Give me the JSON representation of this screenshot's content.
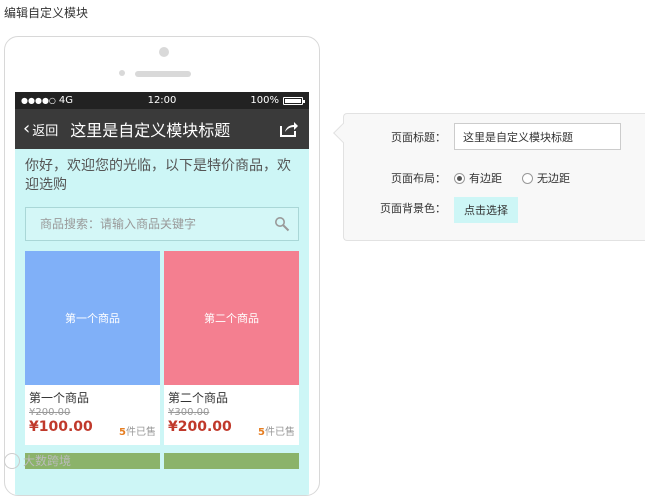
{
  "page": {
    "heading": "编辑自定义模块"
  },
  "phone": {
    "status": {
      "signal": "●●●●○",
      "network": "4G",
      "time": "12:00",
      "battery": "100%"
    },
    "nav": {
      "back_label": "返回",
      "title": "这里是自定义模块标题"
    },
    "welcome_text": "你好，欢迎您的光临，以下是特价商品，欢迎选购",
    "search": {
      "placeholder": "商品搜索：请输入商品关键字"
    },
    "products": [
      {
        "image_label": "第一个商品",
        "name": "第一个商品",
        "original_price": "¥200.00",
        "price": "¥100.00",
        "sold_count": "5",
        "sold_suffix": "件已售",
        "color": "#80b0f8"
      },
      {
        "image_label": "第二个商品",
        "name": "第二个商品",
        "original_price": "¥300.00",
        "price": "¥200.00",
        "sold_count": "5",
        "sold_suffix": "件已售",
        "color": "#f47f90"
      }
    ],
    "background_color": "#cdf6f6"
  },
  "settings": {
    "title_label": "页面标题：",
    "title_value": "这里是自定义模块标题",
    "layout_label": "页面布局：",
    "layout_options": [
      {
        "label": "有边距",
        "selected": true
      },
      {
        "label": "无边距",
        "selected": false
      }
    ],
    "bg_label": "页面背景色：",
    "bg_button": "点击选择"
  },
  "watermark": {
    "text": "大数跨境"
  }
}
